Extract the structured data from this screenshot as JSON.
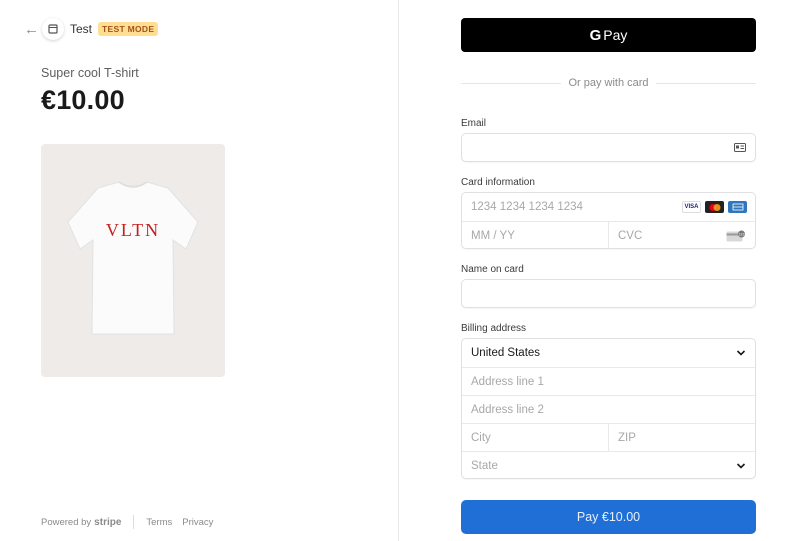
{
  "header": {
    "merchant_name": "Test",
    "badge": "TEST MODE",
    "back_icon": "arrow-left-icon",
    "logo_icon": "store-icon"
  },
  "product": {
    "name": "Super cool T-shirt",
    "price": "€10.00",
    "shirt_text": "VLTN"
  },
  "footer": {
    "powered_by": "Powered by",
    "stripe": "stripe",
    "terms": "Terms",
    "privacy": "Privacy"
  },
  "payment": {
    "gpay_g": "G",
    "gpay_label": "Pay",
    "or_text": "Or pay with card",
    "email_label": "Email",
    "email_value": "",
    "card_label": "Card information",
    "card_number_placeholder": "1234 1234 1234 1234",
    "expiry_placeholder": "MM / YY",
    "cvc_placeholder": "CVC",
    "card_brands": [
      "VISA",
      "mastercard",
      "amex"
    ],
    "name_label": "Name on card",
    "name_value": "",
    "billing_label": "Billing address",
    "country_value": "United States",
    "address1_placeholder": "Address line 1",
    "address2_placeholder": "Address line 2",
    "city_placeholder": "City",
    "zip_placeholder": "ZIP",
    "state_placeholder": "State",
    "pay_button": "Pay €10.00"
  },
  "colors": {
    "pay_button": "#1f6fd6",
    "gpay_button": "#000000",
    "badge_bg": "#ffde92",
    "badge_text": "#a3521a",
    "product_bg": "#efebe8",
    "shirt_logo": "#c4201f"
  }
}
